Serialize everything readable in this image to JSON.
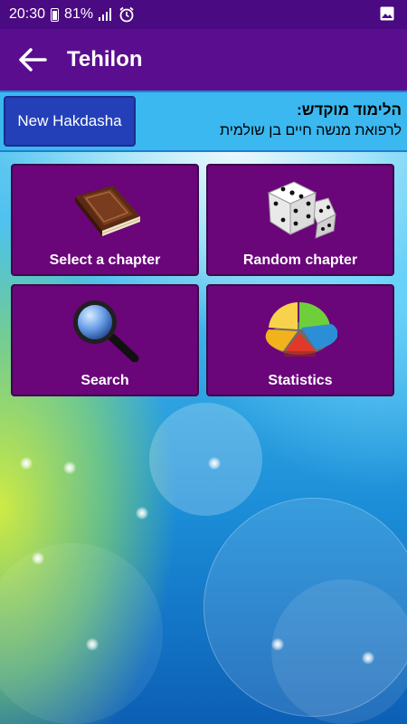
{
  "status_bar": {
    "time": "20:30",
    "battery_percent": "81%",
    "icons": [
      "battery-icon",
      "signal-icon",
      "alarm-icon",
      "gallery-icon"
    ]
  },
  "app_bar": {
    "title": "Tehilon",
    "back_icon": "arrow-left-icon"
  },
  "dedication": {
    "button_label": "New Hakdasha",
    "title": "הלימוד מוקדש:",
    "text": "לרפואת מנשה חיים בן שולמית"
  },
  "menu": {
    "items": [
      {
        "label": "Select a chapter",
        "icon": "book-icon"
      },
      {
        "label": "Random chapter",
        "icon": "dice-icon"
      },
      {
        "label": "Search",
        "icon": "magnifier-icon"
      },
      {
        "label": "Statistics",
        "icon": "pie-chart-icon"
      }
    ]
  },
  "colors": {
    "status_bar": "#4a0a82",
    "app_bar": "#5a0e8f",
    "banner": "#3bb8ef",
    "button": "#2340b8",
    "tile": "#6a057a"
  }
}
